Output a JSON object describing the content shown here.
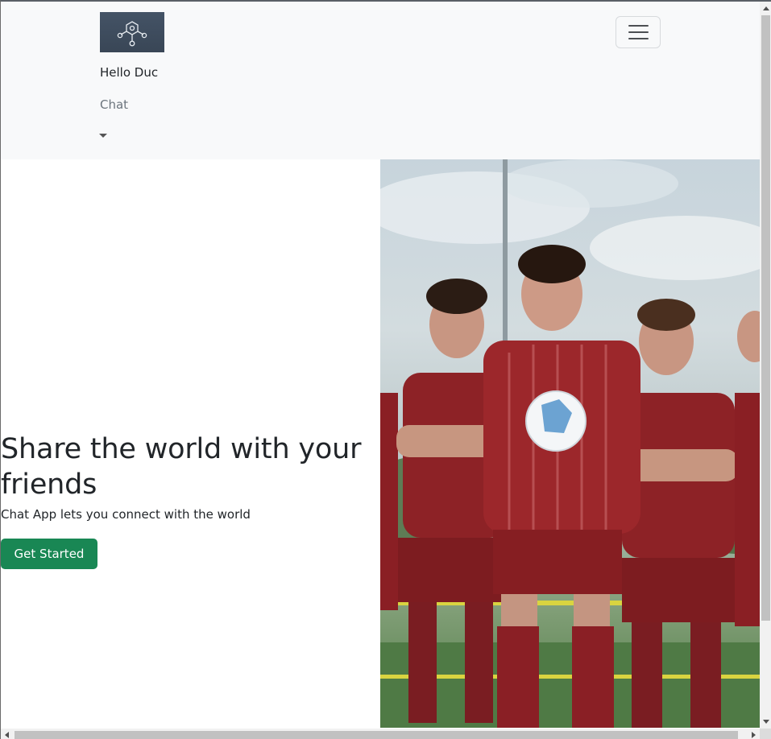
{
  "navbar": {
    "brand_logo": "network-graph-logo",
    "user_greeting": "Hello Duc",
    "chat_link": "Chat",
    "dropdown_icon": "caret-down-icon",
    "toggler_icon": "hamburger-menu-icon",
    "background": "#f8f9fa"
  },
  "hero": {
    "title": "Share the world with your friends",
    "subtitle": "Chat App lets you connect with the world",
    "cta_label": "Get Started",
    "cta_color": "#198754",
    "image": "soccer-team-photo"
  }
}
